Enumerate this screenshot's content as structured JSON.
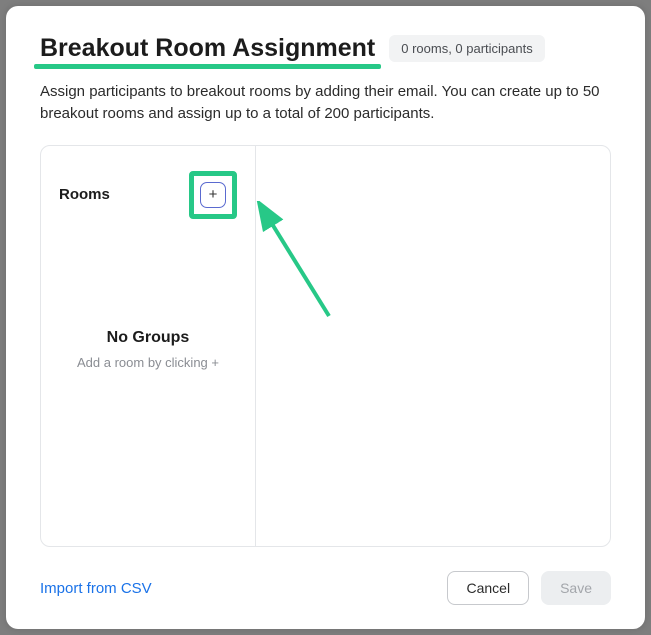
{
  "header": {
    "title": "Breakout Room Assignment",
    "count_text": "0 rooms, 0 participants"
  },
  "description": "Assign participants to breakout rooms by adding their email. You can create up to 50 breakout rooms and assign up to a total of 200 participants.",
  "rooms": {
    "label": "Rooms",
    "add_glyph": "+",
    "empty_title": "No Groups",
    "empty_sub": "Add a room by clicking +"
  },
  "footer": {
    "import_label": "Import from CSV",
    "cancel_label": "Cancel",
    "save_label": "Save"
  },
  "colors": {
    "highlight": "#27c887",
    "link": "#1a72e8"
  }
}
